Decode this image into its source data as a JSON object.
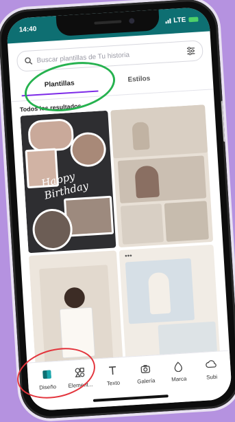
{
  "status_bar": {
    "time": "14:40",
    "network": "LTE"
  },
  "search": {
    "placeholder": "Buscar plantillas de Tu historia"
  },
  "tabs": [
    {
      "label": "Plantillas",
      "active": true
    },
    {
      "label": "Estilos",
      "active": false
    }
  ],
  "section_title": "Todos los resultados",
  "templates": [
    {
      "name": "birthday-collage",
      "text": "Happy Birthday"
    },
    {
      "name": "neutral-photo-collage"
    },
    {
      "name": "white-outfit-story"
    },
    {
      "name": "beige-photo-grid"
    }
  ],
  "bottom_nav": [
    {
      "label": "Diseño",
      "icon": "design-icon",
      "active": true
    },
    {
      "label": "Element...",
      "icon": "elements-icon"
    },
    {
      "label": "Texto",
      "icon": "text-icon"
    },
    {
      "label": "Galería",
      "icon": "camera-icon"
    },
    {
      "label": "Marca",
      "icon": "brand-icon"
    },
    {
      "label": "Subi",
      "icon": "upload-icon"
    }
  ],
  "colors": {
    "background": "#b592e0",
    "status_bar": "#0e6f72",
    "accent": "#7d2ae8",
    "highlight_green": "#26b24f",
    "highlight_red": "#e3343c"
  }
}
